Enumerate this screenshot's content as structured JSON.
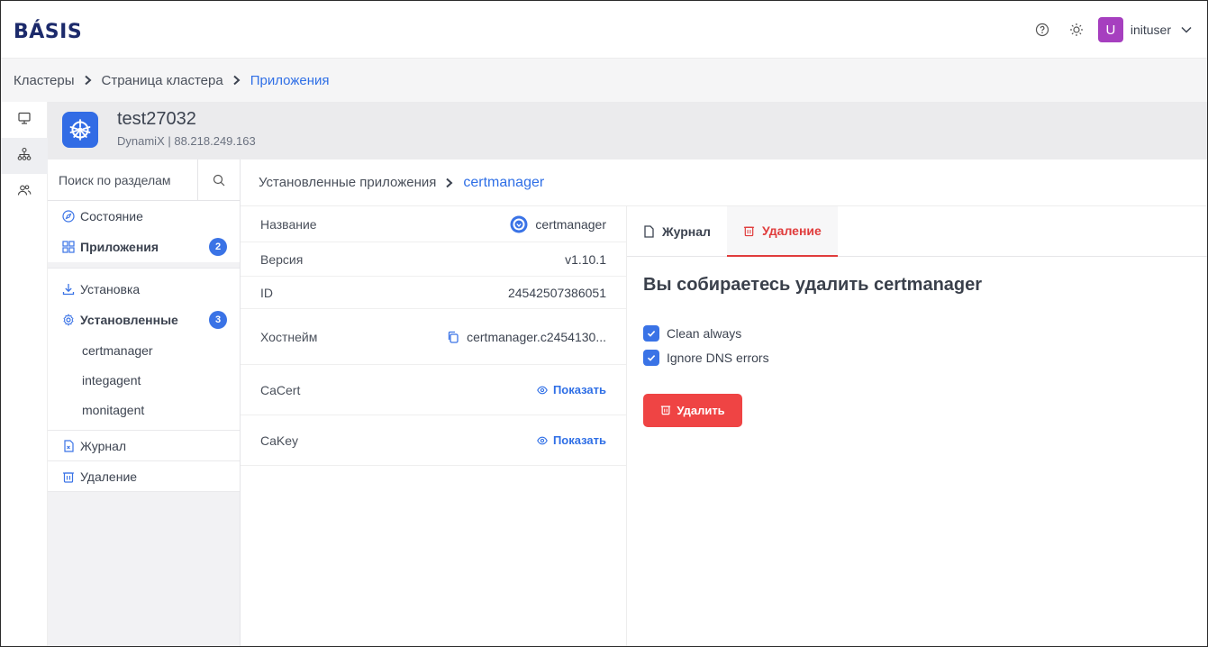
{
  "app": {
    "logo": "BÁSIS"
  },
  "topbar": {
    "username": "inituser",
    "avatar_letter": "U",
    "avatar_color": "#a63fbf"
  },
  "breadcrumb": {
    "items": [
      "Кластеры",
      "Страница кластера",
      "Приложения"
    ]
  },
  "cluster": {
    "name": "test27032",
    "subtitle": "DynamiX | 88.218.249.163"
  },
  "sidebar": {
    "search_placeholder": "Поиск по разделам",
    "status_label": "Состояние",
    "apps_label": "Приложения",
    "apps_count": "2",
    "install_label": "Установка",
    "installed_label": "Установленные",
    "installed_count": "3",
    "installed_apps": [
      "certmanager",
      "integagent",
      "monitagent"
    ],
    "journal_label": "Журнал",
    "delete_label": "Удаление"
  },
  "main": {
    "breadcrumb_parent": "Установленные приложения",
    "breadcrumb_current": "certmanager"
  },
  "props": {
    "name_label": "Название",
    "name_value": "certmanager",
    "version_label": "Версия",
    "version_value": "v1.10.1",
    "id_label": "ID",
    "id_value": "24542507386051",
    "host_label": "Хостнейм",
    "host_value": "certmanager.c2454130...",
    "cacert_label": "CaCert",
    "cacert_link": "Показать",
    "cakey_label": "CaKey",
    "cakey_link": "Показать"
  },
  "details": {
    "tab_journal": "Журнал",
    "tab_delete": "Удаление",
    "title": "Вы собираетесь удалить certmanager",
    "opt_clean": "Clean always",
    "opt_ignore": "Ignore DNS errors",
    "delete_button": "Удалить"
  },
  "colors": {
    "accent": "#2f6fe6",
    "danger": "#ef4444",
    "badge": "#3a73e6"
  }
}
